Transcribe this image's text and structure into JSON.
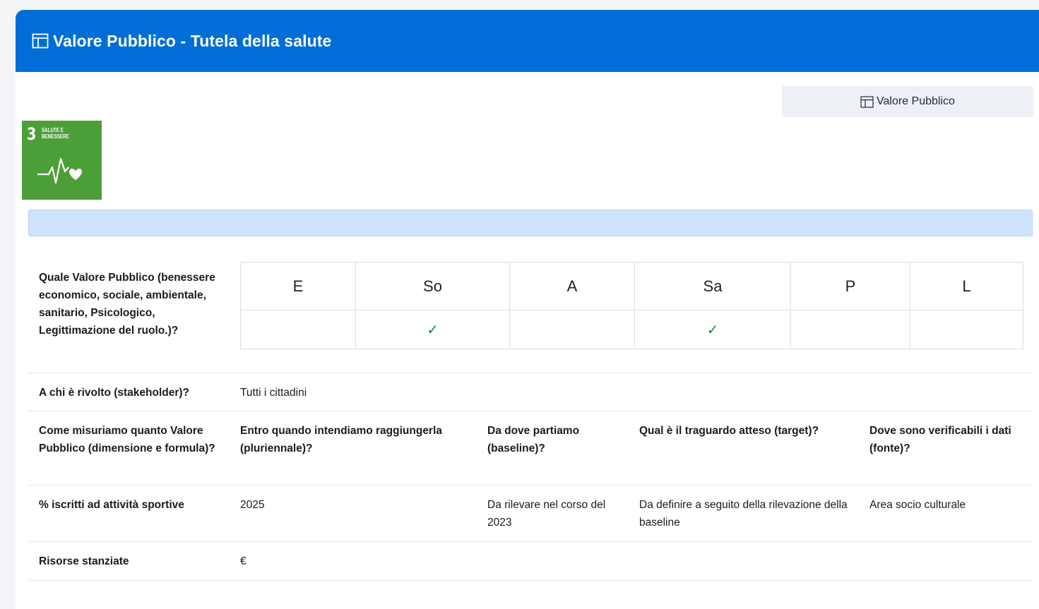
{
  "header": {
    "title": "Valore Pubblico - Tutela della salute",
    "icon": "table-icon"
  },
  "toolbar": {
    "vp_button_label": "Valore Pubblico",
    "vp_button_icon": "table-icon"
  },
  "sdg": {
    "number": "3",
    "label_line1": "SALUTE E",
    "label_line2": "BENESSERE",
    "color": "#4c9f38"
  },
  "colors": {
    "header_bg": "#006ed6",
    "info_bar_bg": "#cfe2fb",
    "check": "#1a8a3a"
  },
  "question_value": {
    "label": "Quale Valore Pubblico (benessere economico, sociale, ambientale, sanitario, Psicologico, Legittimazione del ruolo.)?",
    "dimensions": [
      {
        "code": "E",
        "checked": false
      },
      {
        "code": "So",
        "checked": true
      },
      {
        "code": "A",
        "checked": false
      },
      {
        "code": "Sa",
        "checked": true
      },
      {
        "code": "P",
        "checked": false
      },
      {
        "code": "L",
        "checked": false
      }
    ],
    "check_symbol": "✓"
  },
  "stakeholder": {
    "label": "A chi è rivolto (stakeholder)?",
    "value": "Tutti i cittadini"
  },
  "measure_headers": [
    "Come misuriamo quanto Valore Pubblico (dimensione e formula)?",
    "Entro quando intendiamo raggiungerla (pluriennale)?",
    "Da dove partiamo (baseline)?",
    "Qual è il traguardo atteso (target)?",
    "Dove sono verificabili i dati (fonte)?"
  ],
  "measure_row": [
    "% iscritti ad attività sportive",
    "2025",
    "Da rilevare nel corso del 2023",
    "Da definire a seguito della rilevazione della baseline",
    "Area socio culturale"
  ],
  "resources": {
    "label": "Risorse stanziate",
    "value": "€"
  }
}
